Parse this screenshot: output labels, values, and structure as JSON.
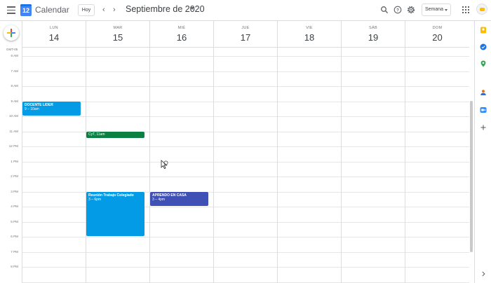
{
  "header": {
    "app_title": "Calendar",
    "logo_day": "12",
    "today_button": "Hoy",
    "prev": "‹",
    "next": "›",
    "month_title": "Septiembre de 2020",
    "view_selector": "Semana",
    "icons": [
      "menu-icon",
      "search-icon",
      "help-icon",
      "settings-icon",
      "apps-icon",
      "account-avatar"
    ]
  },
  "days": [
    {
      "dow": "LUN",
      "num": "14"
    },
    {
      "dow": "MAR",
      "num": "15"
    },
    {
      "dow": "MIÉ",
      "num": "16"
    },
    {
      "dow": "JUE",
      "num": "17"
    },
    {
      "dow": "VIE",
      "num": "18"
    },
    {
      "dow": "SÁB",
      "num": "19"
    },
    {
      "dow": "DOM",
      "num": "20"
    }
  ],
  "timezone": "GMT-05",
  "hours": [
    "6 AM",
    "7 AM",
    "8 AM",
    "9 AM",
    "10 AM",
    "11 AM",
    "12 PM",
    "1 PM",
    "2 PM",
    "3 PM",
    "4 PM",
    "5 PM",
    "6 PM",
    "7 PM",
    "8 PM"
  ],
  "events": [
    {
      "title": "DOCENTE LIDER",
      "time": "9 – 10am",
      "color": "#039be5",
      "day": 0,
      "start": 9,
      "end": 10
    },
    {
      "title": "CyT, 11am",
      "time": "",
      "color": "#0b8043",
      "day": 1,
      "start": 11,
      "end": 11.5
    },
    {
      "title": "Reunión Trabajo Colegiado",
      "time": "3 – 6pm",
      "color": "#039be5",
      "day": 1,
      "start": 15,
      "end": 18
    },
    {
      "title": "APRENDO EN CASA",
      "time": "3 – 4pm",
      "color": "#3f51b5",
      "day": 2,
      "start": 15,
      "end": 16
    }
  ],
  "side_panel": [
    "keep-icon",
    "tasks-icon",
    "maps-icon",
    "contacts-icon",
    "zoom-icon",
    "add-addon-icon",
    "expand-icon"
  ],
  "colors": {
    "accent": "#1a73e8",
    "event_blue": "#039be5",
    "event_green": "#0b8043",
    "event_indigo": "#3f51b5"
  }
}
